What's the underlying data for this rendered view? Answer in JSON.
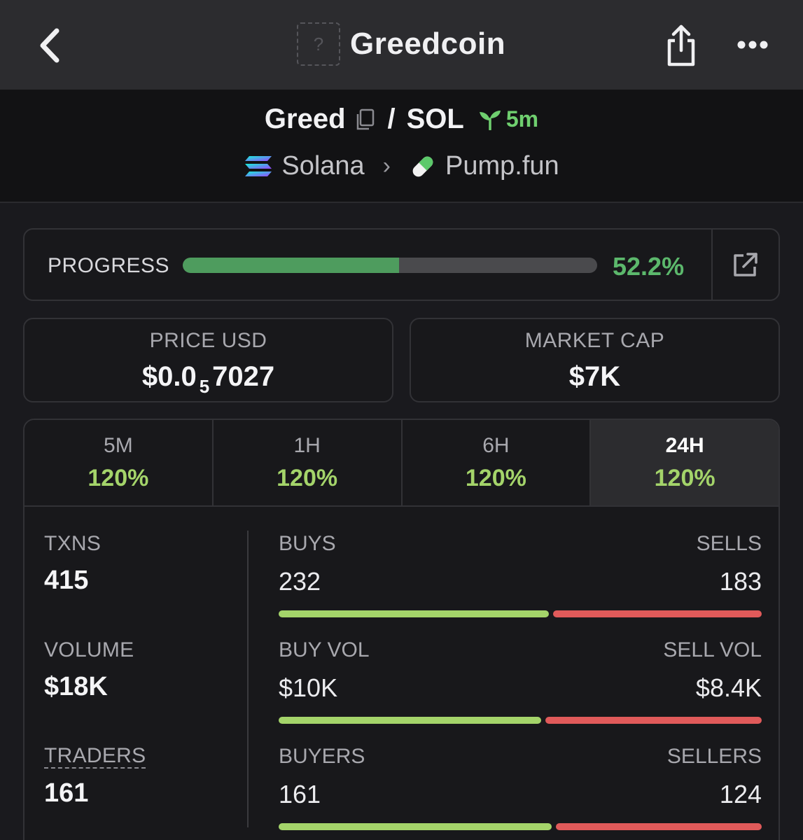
{
  "topbar": {
    "title": "Greedcoin",
    "avatar_placeholder": "?"
  },
  "pair": {
    "base": "Greed",
    "slash": "/",
    "quote": "SOL",
    "age": "5m",
    "chain": "Solana",
    "dex": "Pump.fun"
  },
  "progress": {
    "label": "PROGRESS",
    "value_text": "52.2%",
    "fraction": 0.522
  },
  "price": {
    "label": "PRICE USD",
    "prefix": "$0.0",
    "zeros_subscript": "5",
    "digits": "7027"
  },
  "market_cap": {
    "label": "MARKET CAP",
    "value": "$7K"
  },
  "timeframes": [
    {
      "name": "5M",
      "change": "120%"
    },
    {
      "name": "1H",
      "change": "120%"
    },
    {
      "name": "6H",
      "change": "120%"
    },
    {
      "name": "24H",
      "change": "120%"
    }
  ],
  "active_timeframe": "24H",
  "stats": {
    "txns": {
      "label": "TXNS",
      "value": "415"
    },
    "volume": {
      "label": "VOLUME",
      "value": "$18K"
    },
    "traders": {
      "label": "TRADERS",
      "value": "161"
    },
    "buys_sells": {
      "left_label": "BUYS",
      "left_value": "232",
      "right_label": "SELLS",
      "right_value": "183",
      "left_fraction": 0.559
    },
    "buy_sell_vol": {
      "left_label": "BUY VOL",
      "left_value": "$10K",
      "right_label": "SELL VOL",
      "right_value": "$8.4K",
      "left_fraction": 0.543
    },
    "buyers_sellers": {
      "left_label": "BUYERS",
      "left_value": "161",
      "right_label": "SELLERS",
      "right_value": "124",
      "left_fraction": 0.565
    }
  },
  "colors": {
    "buy": "#a4d46a",
    "sell": "#e05a5a",
    "progress": "#4e9c5e",
    "positive_text": "#5cb86c"
  }
}
